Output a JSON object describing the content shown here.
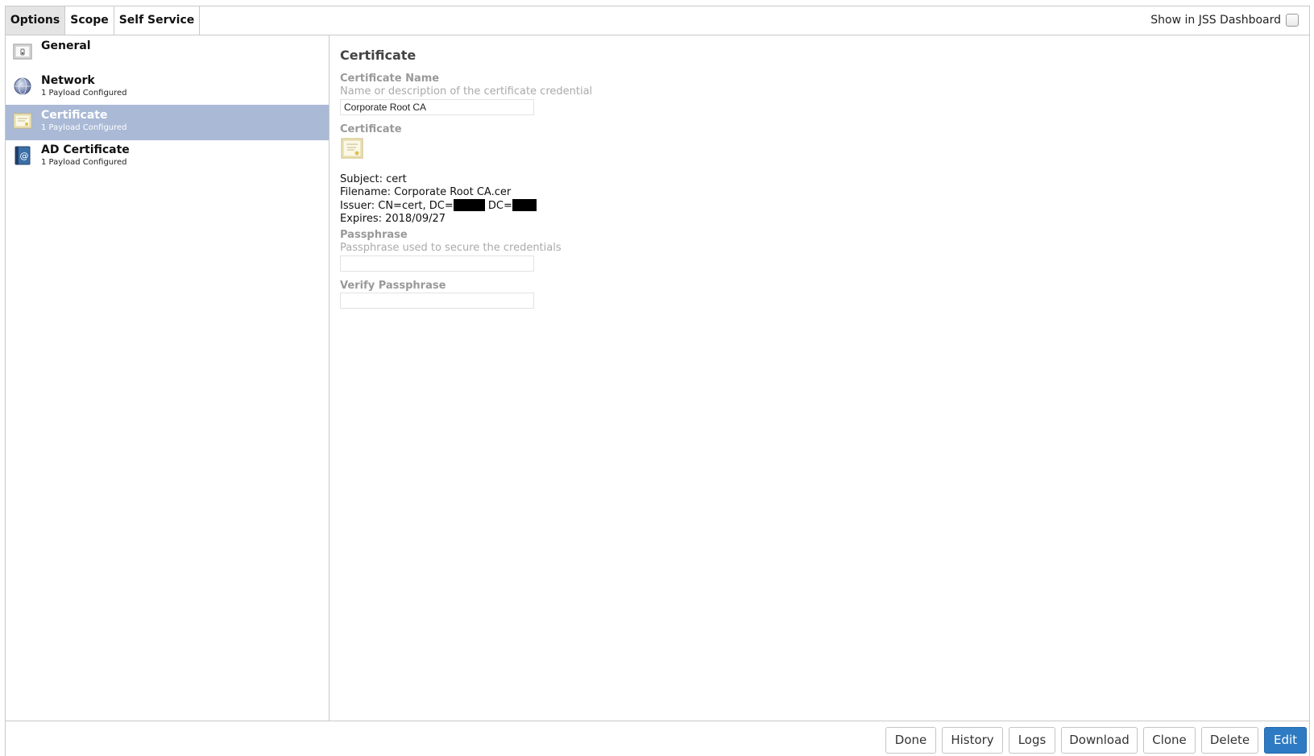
{
  "tabs": [
    {
      "label": "Options"
    },
    {
      "label": "Scope"
    },
    {
      "label": "Self Service"
    }
  ],
  "dashboard": {
    "label": "Show in JSS Dashboard",
    "checked": false
  },
  "sidebar": {
    "items": [
      {
        "title": "General",
        "subtitle": "",
        "icon": "switch-icon"
      },
      {
        "title": "Network",
        "subtitle": "1 Payload Configured",
        "icon": "globe-icon"
      },
      {
        "title": "Certificate",
        "subtitle": "1 Payload Configured",
        "icon": "certificate-icon",
        "selected": true
      },
      {
        "title": "AD Certificate",
        "subtitle": "1 Payload Configured",
        "icon": "address-book-icon"
      }
    ]
  },
  "main": {
    "heading": "Certificate",
    "cert_name": {
      "label": "Certificate Name",
      "description": "Name or description of the certificate credential",
      "value": "Corporate Root CA"
    },
    "certificate": {
      "label": "Certificate",
      "subject": "Subject: cert",
      "filename": "Filename: Corporate Root CA.cer",
      "issuer_prefix": "Issuer: CN=cert, DC=",
      "issuer_mid": " DC=",
      "expires": "Expires: 2018/09/27"
    },
    "passphrase": {
      "label": "Passphrase",
      "description": "Passphrase used to secure the credentials",
      "value": ""
    },
    "verify_passphrase": {
      "label": "Verify Passphrase",
      "value": ""
    }
  },
  "buttons": {
    "done": "Done",
    "history": "History",
    "logs": "Logs",
    "download": "Download",
    "clone": "Clone",
    "delete": "Delete",
    "edit": "Edit"
  },
  "colors": {
    "selected_bg": "#a9b9d6",
    "primary_button": "#2e7bc4"
  }
}
